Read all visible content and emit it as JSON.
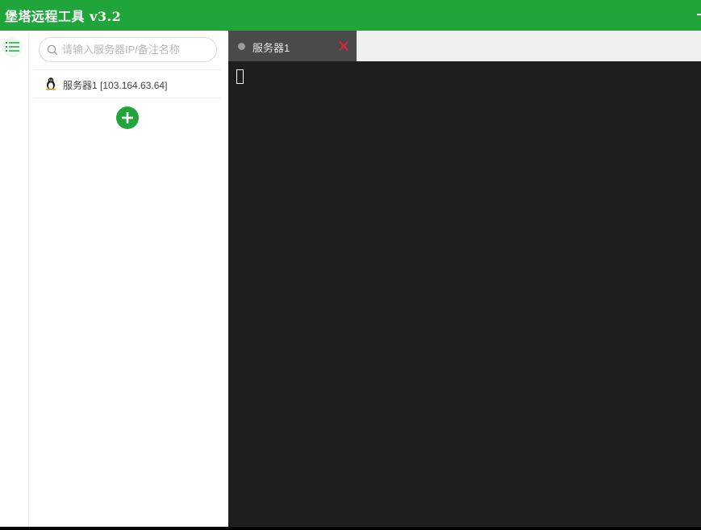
{
  "app": {
    "title": "堡塔远程工具 v3.2"
  },
  "colors": {
    "brand": "#20a53a",
    "tab_background": "#4a4a4a",
    "terminal_background": "#1e1e1e",
    "close_icon": "#e0203a"
  },
  "sidebar": {
    "menu_icon": "list-icon",
    "search": {
      "placeholder": "请输入服务器IP/备注名称",
      "value": ""
    },
    "servers": [
      {
        "label": "服务器1 [103.164.63.64]",
        "os_icon": "linux-penguin-icon"
      }
    ],
    "add_icon": "plus-circle-icon"
  },
  "tabs": [
    {
      "label": "服务器1",
      "status_icon": "status-dot-icon",
      "close_icon": "close-icon"
    }
  ],
  "terminal": {
    "content": ""
  }
}
